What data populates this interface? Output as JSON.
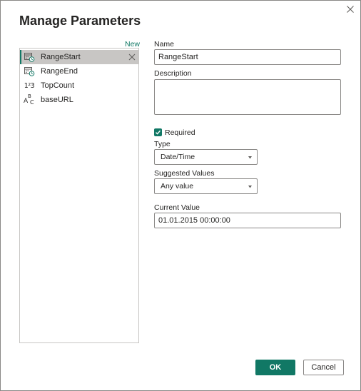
{
  "dialog": {
    "title": "Manage Parameters",
    "new_label": "New"
  },
  "parameters": [
    {
      "label": "RangeStart",
      "icon": "datetime-icon",
      "selected": true
    },
    {
      "label": "RangeEnd",
      "icon": "datetime-icon",
      "selected": false
    },
    {
      "label": "TopCount",
      "icon": "number-icon",
      "selected": false
    },
    {
      "label": "baseURL",
      "icon": "text-icon",
      "selected": false
    }
  ],
  "icons": {
    "number_glyph": "1²3",
    "text_glyph_a": "A",
    "text_glyph_b": "B",
    "text_glyph_c": "C"
  },
  "form": {
    "name_label": "Name",
    "name_value": "RangeStart",
    "description_label": "Description",
    "description_value": "",
    "required_label": "Required",
    "required_checked": true,
    "type_label": "Type",
    "type_value": "Date/Time",
    "suggested_label": "Suggested Values",
    "suggested_value": "Any value",
    "current_label": "Current Value",
    "current_value": "01.01.2015 00:00:00"
  },
  "buttons": {
    "ok_label": "OK",
    "cancel_label": "Cancel"
  },
  "colors": {
    "accent": "#117865",
    "selected_bg": "#c8c6c4",
    "border": "#8a8886"
  }
}
